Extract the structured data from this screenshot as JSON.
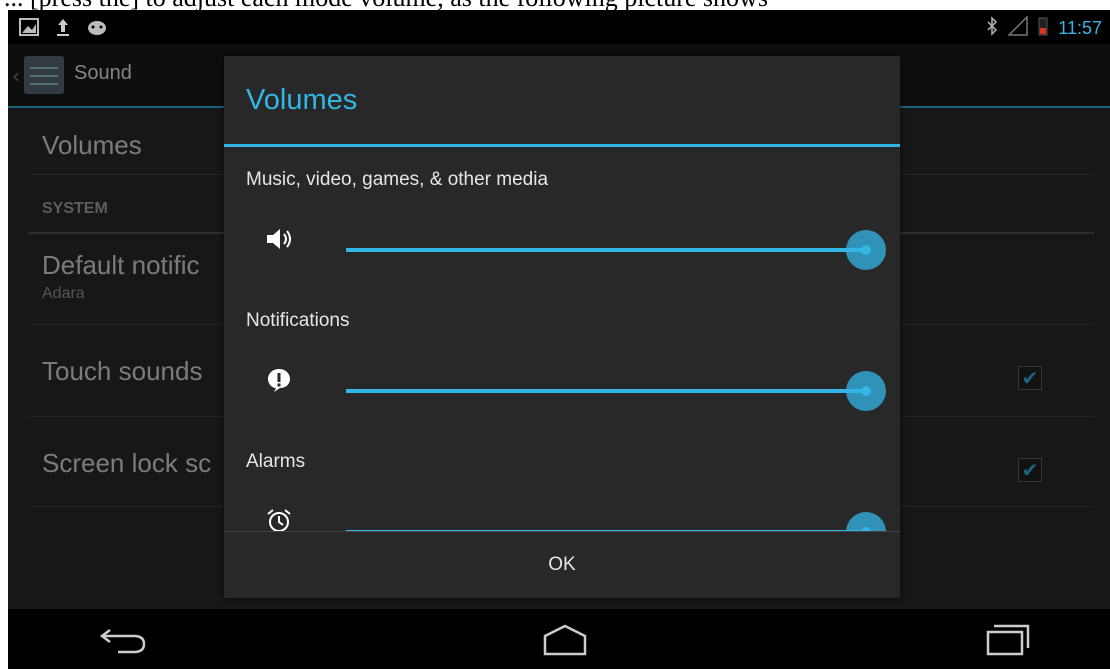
{
  "caption": "... [press the] to adjust each mode volume, as the following picture shows",
  "status_bar": {
    "time": "11:57",
    "left_icons": [
      "gallery-icon",
      "upload-icon",
      "android-icon"
    ],
    "right_icons": [
      "bluetooth-icon",
      "signal-icon",
      "battery-icon"
    ]
  },
  "app": {
    "title": "Sound",
    "volumes_label": "Volumes",
    "section_header": "SYSTEM",
    "default_notification": {
      "title": "Default notific",
      "summary": "Adara"
    },
    "touch_sounds": {
      "title": "Touch sounds",
      "checked": true
    },
    "screen_lock": {
      "title": "Screen lock sc",
      "checked": true
    }
  },
  "dialog": {
    "title": "Volumes",
    "sliders": [
      {
        "label": "Music, video, games, & other media",
        "icon": "speaker-icon",
        "level": 1.0
      },
      {
        "label": "Notifications",
        "icon": "notification-icon",
        "level": 1.0
      },
      {
        "label": "Alarms",
        "icon": "alarm-icon",
        "level": 1.0
      }
    ],
    "ok_label": "OK"
  },
  "colors": {
    "accent": "#33b5e5",
    "dialog_bg": "#282828",
    "app_bg": "#2b2b2b"
  }
}
